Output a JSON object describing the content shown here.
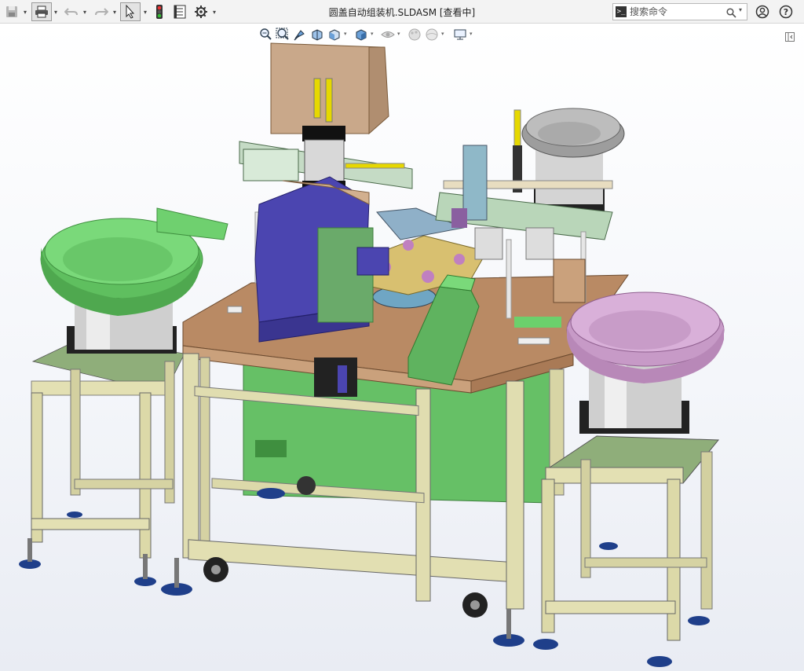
{
  "window": {
    "title": "圆盖自动组装机.SLDASM [查看中]"
  },
  "toolbar": {
    "items": [
      "save-icon",
      "print-icon",
      "undo-icon",
      "redo-icon",
      "select-icon",
      "rebuild-traffic-light-icon",
      "file-properties-icon",
      "options-gear-icon"
    ]
  },
  "search": {
    "placeholder": "搜索命令"
  },
  "view_toolbar": {
    "items": [
      "zoom-to-fit-icon",
      "zoom-to-area-icon",
      "previous-view-icon",
      "section-view-icon",
      "view-orientation-icon",
      "display-style-icon",
      "hide-show-items-icon",
      "edit-appearance-icon",
      "apply-scene-icon",
      "view-settings-icon"
    ]
  },
  "model": {
    "name": "圆盖自动组装机",
    "colors": {
      "frame": "#d9d6a8",
      "table_top": "#b98a64",
      "green_panel": "#6cc46c",
      "bowl_left": "#6fd06f",
      "bowl_right": "#cfa0cf",
      "bowl_back": "#a9a9a9",
      "press_blue": "#4b45b0",
      "sign_panel": "#c9a88a",
      "feet": "#1f3f8a"
    }
  }
}
